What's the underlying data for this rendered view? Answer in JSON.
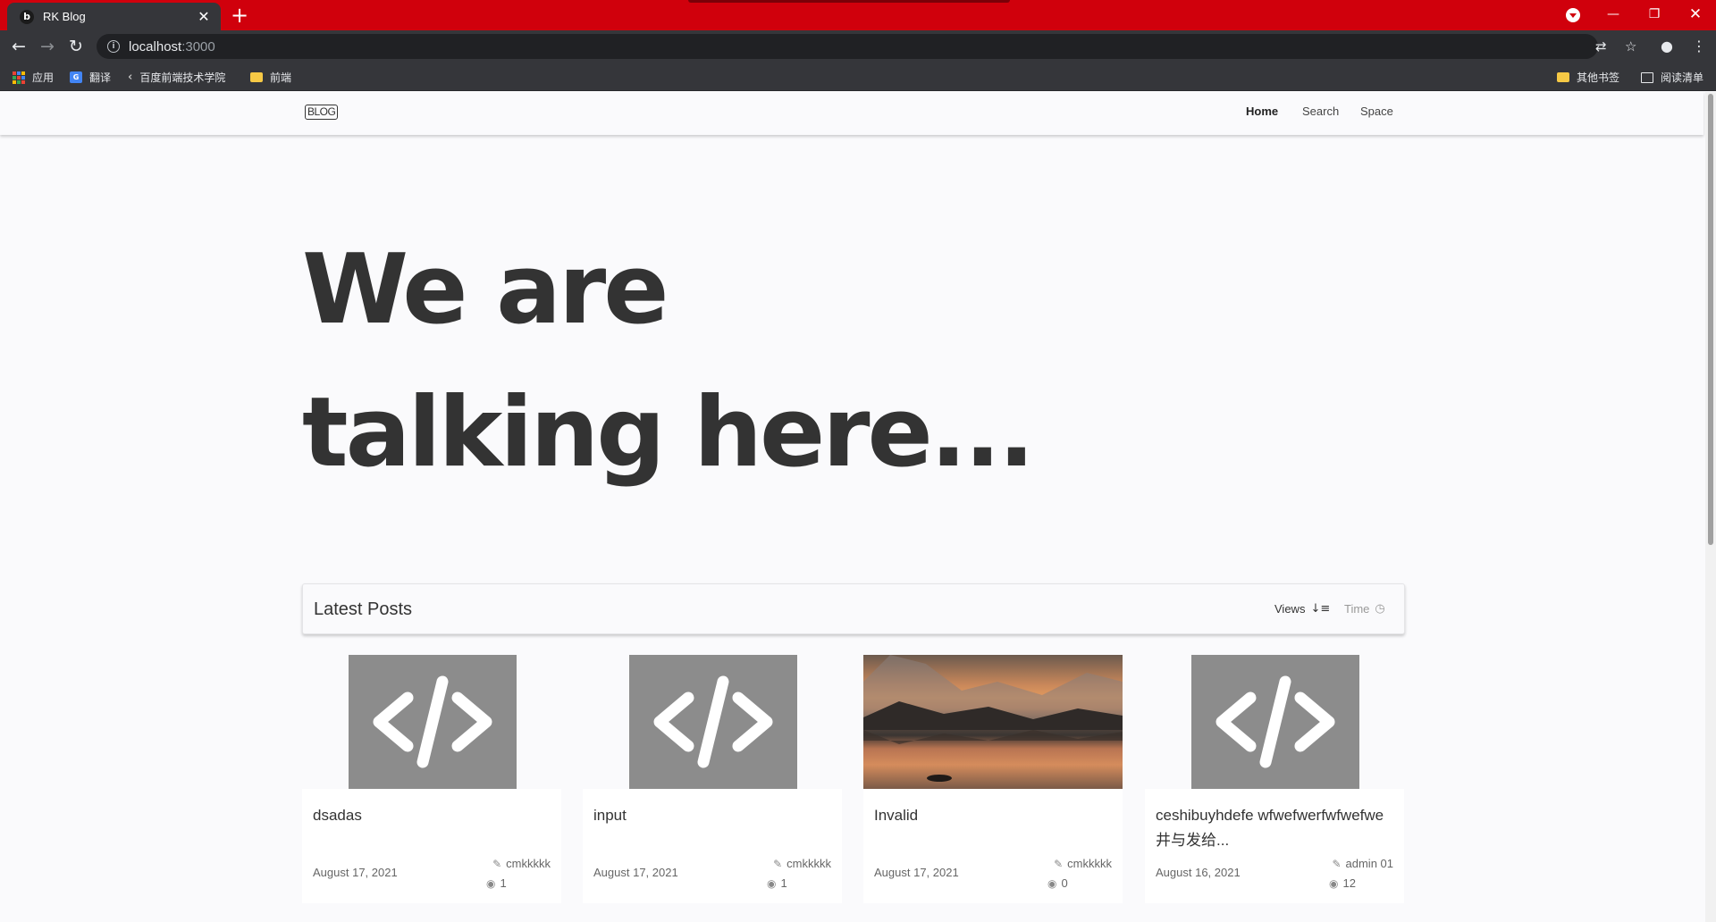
{
  "browser": {
    "tab_title": "RK Blog",
    "favicon_letter": "b",
    "url_host": "localhost",
    "url_port": ":3000",
    "accent_color": "#d0000c"
  },
  "bookmarks": {
    "apps": "应用",
    "translate": "翻译",
    "baidu": "百度前端技术学院",
    "frontend": "前端",
    "other": "其他书签",
    "reading_list": "阅读清单"
  },
  "site": {
    "logo": "BLOG",
    "nav": {
      "home": "Home",
      "search": "Search",
      "space": "Space"
    }
  },
  "hero": {
    "line1": "We are",
    "line2": "talking here..."
  },
  "posts": {
    "title": "Latest Posts",
    "sort_views": "Views",
    "sort_time": "Time",
    "items": [
      {
        "title": "dsadas",
        "date": "August 17, 2021",
        "author": "cmkkkkk",
        "views": "1",
        "thumb": "code-icon"
      },
      {
        "title": "input",
        "date": "August 17, 2021",
        "author": "cmkkkkk",
        "views": "1",
        "thumb": "code-icon"
      },
      {
        "title": "Invalid",
        "date": "August 17, 2021",
        "author": "cmkkkkk",
        "views": "0",
        "thumb": "landscape-photo"
      },
      {
        "title": "ceshibuyhdefe wfwefwerfwfwefwe 井与发给...",
        "date": "August 16, 2021",
        "author": "admin 01",
        "views": "12",
        "thumb": "code-icon"
      }
    ]
  }
}
